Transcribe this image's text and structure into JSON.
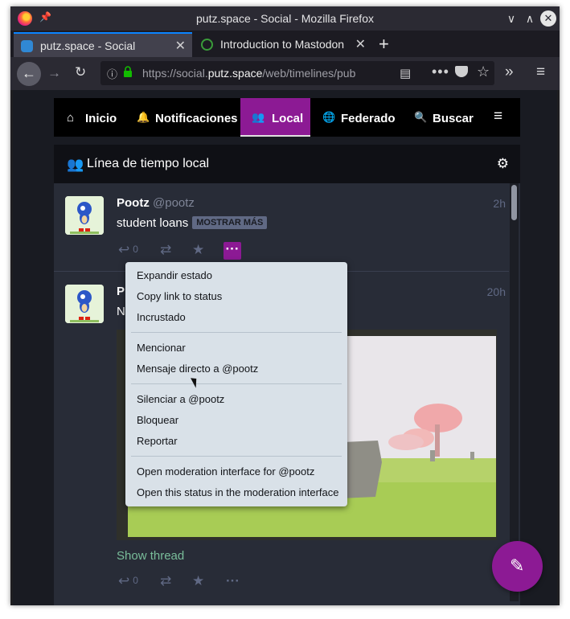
{
  "window": {
    "title": "putz.space - Social - Mozilla Firefox",
    "controls": {
      "minimize": "∨",
      "maximize": "∧",
      "close": "✕"
    }
  },
  "browser_tabs": [
    {
      "label": "putz.space - Social",
      "active": true,
      "icon": "mastodon-favicon"
    },
    {
      "label": "Introduction to Mastodon",
      "active": false,
      "icon": "globe-favicon"
    }
  ],
  "navbar": {
    "url_prefix": "https://social.",
    "url_domain": "putz.space",
    "url_path": "/web/timelines/pub",
    "more_label": "•••"
  },
  "nav_tabs": [
    {
      "icon": "⌂",
      "label": "Inicio"
    },
    {
      "icon": "🔔",
      "label": "Notificaciones"
    },
    {
      "icon": "👥",
      "label": "Local"
    },
    {
      "icon": "🌐",
      "label": "Federado"
    },
    {
      "icon": "🔍",
      "label": "Buscar"
    }
  ],
  "column": {
    "icon": "👥",
    "title": "Línea de tiempo local"
  },
  "statuses": [
    {
      "display_name": "Pootz",
      "acct": "@pootz",
      "time": "2h",
      "content": "student loans",
      "cw_button": "MOSTRAR MÁS",
      "reply_count": "0"
    },
    {
      "display_name": "P",
      "content_initial": "N",
      "time": "20h",
      "show_thread": "Show thread",
      "reply_count": "0"
    }
  ],
  "dropdown": {
    "groups": [
      [
        "Expandir estado",
        "Copy link to status",
        "Incrustado"
      ],
      [
        "Mencionar",
        "Mensaje directo a @pootz"
      ],
      [
        "Silenciar a @pootz",
        "Bloquear",
        "Reportar"
      ],
      [
        "Open moderation interface for @pootz",
        "Open this status in the moderation interface"
      ]
    ]
  },
  "colors": {
    "accent": "#8c1a94",
    "thread_link": "#79bd9a",
    "firefox_tab_highlight": "#0a84ff"
  }
}
